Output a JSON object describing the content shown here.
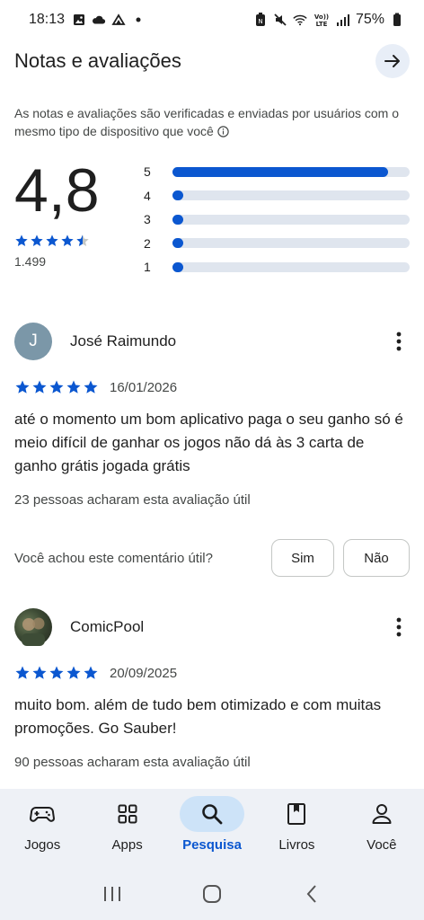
{
  "status_bar": {
    "time": "18:13",
    "network_label": "Vo))\nLTE",
    "signal_label": "6",
    "battery_percent": "75%"
  },
  "header": {
    "title": "Notas e avaliações"
  },
  "intro_text": "As notas e avaliações são verificadas e enviadas por usuários com o mesmo tipo de dispositivo que você",
  "summary": {
    "average": "4,8",
    "average_stars": 4.5,
    "total": "1.499",
    "histogram": [
      {
        "label": "5",
        "fraction": 0.91
      },
      {
        "label": "4",
        "fraction": 0.02
      },
      {
        "label": "3",
        "fraction": 0.02
      },
      {
        "label": "2",
        "fraction": 0.02
      },
      {
        "label": "1",
        "fraction": 0.02
      }
    ]
  },
  "reviews": [
    {
      "name": "José Raimundo",
      "initial": "J",
      "stars": 5,
      "date": "16/01/2026",
      "text": "até o momento um bom aplicativo paga o seu ganho só é meio difícil de ganhar os jogos não dá às 3 carta de ganho grátis jogada grátis",
      "helpful": "23 pessoas acharam esta avaliação útil"
    },
    {
      "name": "ComicPool",
      "stars": 5,
      "date": "20/09/2025",
      "text": "muito bom. além de tudo bem otimizado e com muitas promoções. Go Sauber!",
      "helpful": "90 pessoas acharam esta avaliação útil"
    }
  ],
  "helpful_prompt": {
    "question": "Você achou este comentário útil?",
    "yes": "Sim",
    "no": "Não"
  },
  "bottom_nav": [
    {
      "label": "Jogos",
      "icon": "gamepad-icon",
      "active": false
    },
    {
      "label": "Apps",
      "icon": "apps-grid-icon",
      "active": false
    },
    {
      "label": "Pesquisa",
      "icon": "search-icon",
      "active": true
    },
    {
      "label": "Livros",
      "icon": "book-icon",
      "active": false
    },
    {
      "label": "Você",
      "icon": "person-icon",
      "active": false
    }
  ],
  "colors": {
    "accent": "#0b57d0",
    "track": "#dfe5ee",
    "nav_background": "#eef1f6",
    "active_pill": "#cde3f8"
  }
}
